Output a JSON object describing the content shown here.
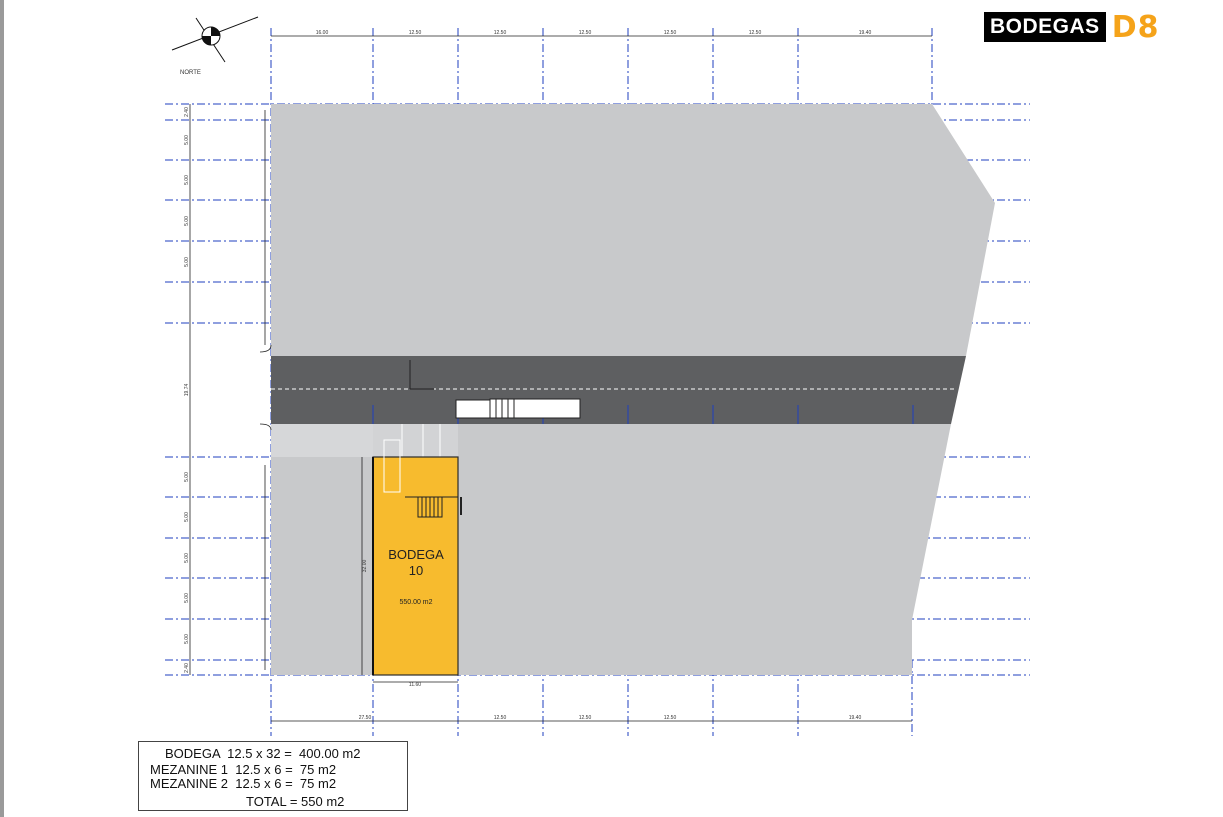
{
  "brand": {
    "name": "BODEGAS",
    "accent": "D8",
    "accent_color": "#f5a31a"
  },
  "compass": {
    "label": "NORTE"
  },
  "unit": {
    "title": "BODEGA",
    "number": "10",
    "area": "550.00 m2",
    "fill_color": "#f7bb2e"
  },
  "dimensions": {
    "top": [
      "16.00",
      "12.50",
      "12.50",
      "12.50",
      "12.50",
      "12.50",
      "19.40"
    ],
    "bottom": [
      "27.50",
      "12.50",
      "12.50",
      "12.50",
      "19.40"
    ],
    "left": [
      "2.40",
      "5.00",
      "5.00",
      "5.00",
      "5.00",
      "19.74",
      "5.00",
      "5.00",
      "5.00",
      "5.00",
      "5.00",
      "2.40"
    ],
    "unit_width": "11.60",
    "unit_depth": "32.00"
  },
  "summary": {
    "rows": [
      "BODEGA  12.5 x 32 =  400.00 m2",
      "MEZANINE 1  12.5 x 6 =  75 m2",
      "MEZANINE 2  12.5 x 6 =  75 m2",
      "TOTAL = 550 m2"
    ]
  },
  "colors": {
    "lot": "#c8c9cb",
    "street": "#5e5f61",
    "grid": "#1f3fbf",
    "unit_outline": "#2a2a2a"
  }
}
